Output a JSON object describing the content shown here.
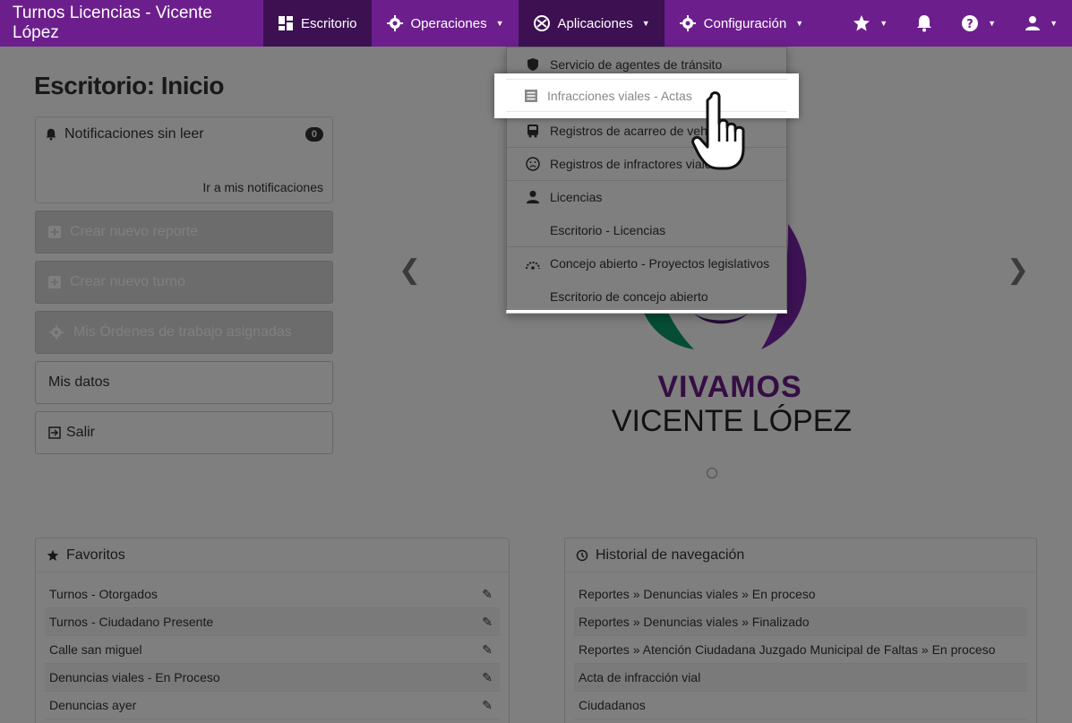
{
  "navbar": {
    "brand": "Turnos Licencias - Vicente López",
    "items": [
      {
        "label": "Escritorio",
        "icon": "dashboard-icon"
      },
      {
        "label": "Operaciones",
        "icon": "gear-cog-icon"
      },
      {
        "label": "Aplicaciones",
        "icon": "apps-icon"
      },
      {
        "label": "Configuración",
        "icon": "settings-icon"
      }
    ]
  },
  "page": {
    "title": "Escritorio: Inicio"
  },
  "notifications": {
    "title": "Notificaciones sin leer",
    "count": "0",
    "link": "Ir a mis notificaciones"
  },
  "buttons": {
    "crear_reporte": "Crear nuevo reporte",
    "crear_turno": "Crear nuevo turno",
    "ordenes": "Mis Órdenes de trabajo asignadas",
    "mis_datos": "Mis datos",
    "salir": "Salir"
  },
  "logo": {
    "line1": "VIVAMOS",
    "line2": "VICENTE LÓPEZ"
  },
  "favoritos": {
    "title": "Favoritos",
    "items": [
      "Turnos - Otorgados",
      "Turnos - Ciudadano Presente",
      "Calle san miguel",
      "Denuncias viales - En Proceso",
      "Denuncias ayer"
    ]
  },
  "historial": {
    "title": "Historial de navegación",
    "items": [
      "Reportes » Denuncias viales » En proceso",
      "Reportes » Denuncias viales » Finalizado",
      "Reportes » Atención Ciudadana Juzgado Municipal de Faltas » En proceso",
      "Acta de infracción vial",
      "Ciudadanos"
    ]
  },
  "dropdown": {
    "items": [
      {
        "label": "Servicio de agentes de tránsito",
        "icon": "shield-icon"
      },
      {
        "label": "Infracciones viales - Actas",
        "icon": "document-list-icon"
      },
      {
        "label": "Registros de acarreo de veh",
        "icon": "bus-icon"
      },
      {
        "label": "Registros de infractores viale",
        "icon": "frown-face-icon"
      },
      {
        "label": "Licencias",
        "icon": "user-icon"
      },
      {
        "label": "Escritorio - Licencias",
        "icon": ""
      },
      {
        "label": "Concejo abierto - Proyectos legislativos",
        "icon": "gauge-icon"
      },
      {
        "label": "Escritorio de concejo abierto",
        "icon": ""
      }
    ]
  },
  "colors": {
    "navbar": "#6c1f8c",
    "navbar_active": "#3d1052",
    "logo_purple": "#6a1d86"
  }
}
